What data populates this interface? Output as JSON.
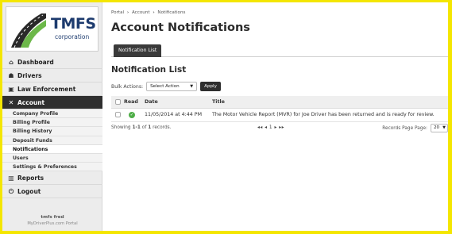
{
  "brand": {
    "logo_text": "TMFS",
    "logo_subtext": "corporation"
  },
  "sidebar": {
    "nav": [
      {
        "label": "Dashboard",
        "icon": "home-icon",
        "glyph": "⌂"
      },
      {
        "label": "Drivers",
        "icon": "drivers-icon",
        "glyph": "☗"
      },
      {
        "label": "Law Enforcement",
        "icon": "law-enforcement-icon",
        "glyph": "▣"
      },
      {
        "label": "Account",
        "icon": "account-tools-icon",
        "glyph": "✕"
      },
      {
        "label": "Reports",
        "icon": "reports-icon",
        "glyph": "▥"
      },
      {
        "label": "Logout",
        "icon": "logout-icon",
        "glyph": "⏻"
      }
    ],
    "account_sub": [
      "Company Profile",
      "Billing Profile",
      "Billing History",
      "Deposit Funds",
      "Notifications",
      "Users",
      "Settings & Preferences"
    ],
    "user_name": "tmfs fred",
    "portal_name": "MyDriverPlus.com Portal"
  },
  "breadcrumb": [
    "Portal",
    "Account",
    "Notifications"
  ],
  "page_title": "Account Notifications",
  "tab_label": "Notification List",
  "section_title": "Notification List",
  "bulk": {
    "label": "Bulk Actions:",
    "select_value": "Select Action",
    "apply_label": "Apply"
  },
  "table": {
    "headers": {
      "read": "Read",
      "date": "Date",
      "title": "Title"
    },
    "rows": [
      {
        "date": "11/05/2014 at 4:44 PM",
        "title": "The Motor Vehicle Report (MVR) for Joe Driver has been returned and is ready for review."
      }
    ]
  },
  "footer": {
    "showing_prefix": "Showing ",
    "showing_range": "1-1",
    "showing_of": " of ",
    "showing_total": "1",
    "showing_suffix": " records.",
    "pager": "◂◂ ◂ 1 ▸ ▸▸",
    "rpp_label": "Records Page Page:",
    "rpp_value": "20"
  },
  "colors": {
    "frame": "#f4e600",
    "sidebar_active": "#2f2f2f",
    "read_ok": "#4fae48",
    "brand": "#1d3b6e"
  }
}
